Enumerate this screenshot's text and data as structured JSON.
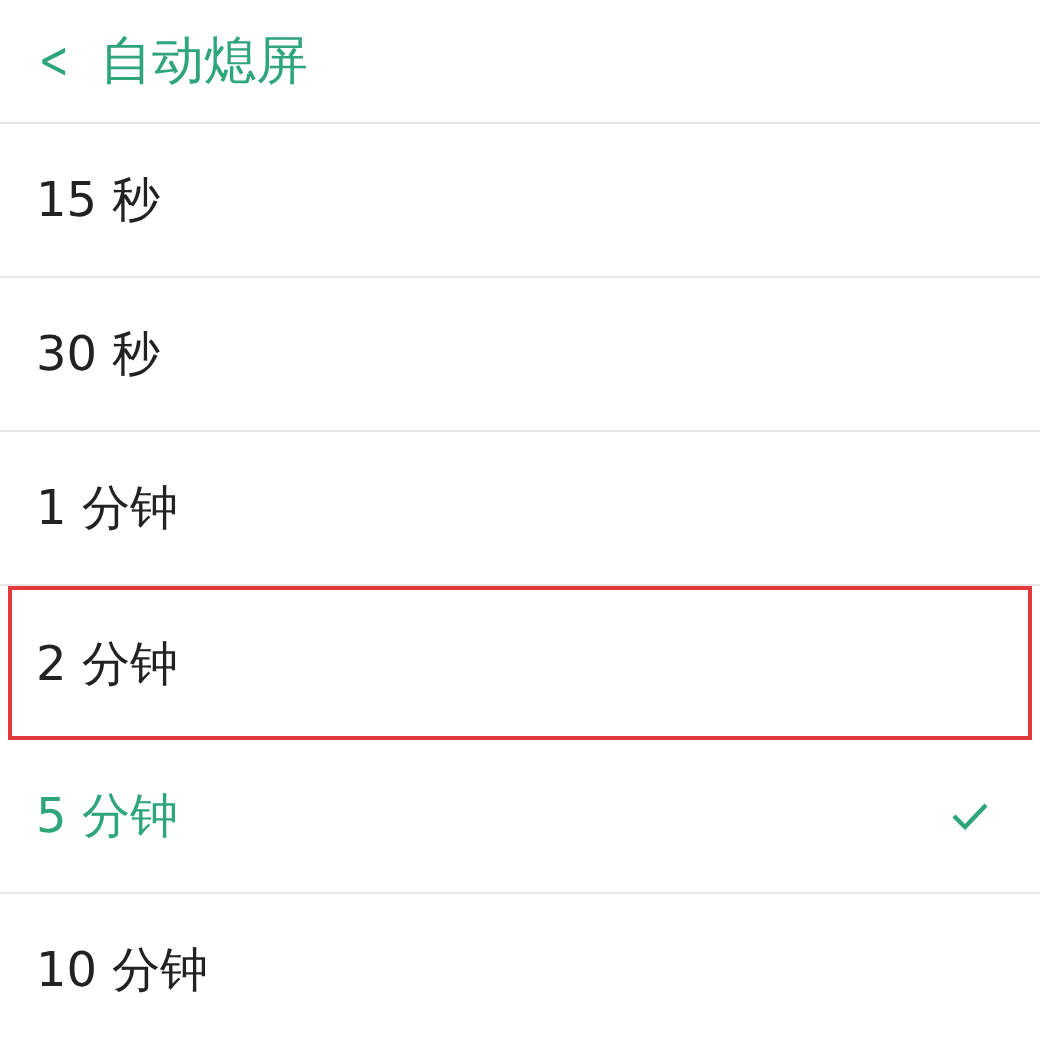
{
  "header": {
    "back_icon": "<",
    "title": "自动熄屏"
  },
  "options": [
    {
      "label": "15 秒",
      "selected": false,
      "highlighted": false
    },
    {
      "label": "30 秒",
      "selected": false,
      "highlighted": false
    },
    {
      "label": "1 分钟",
      "selected": false,
      "highlighted": false
    },
    {
      "label": "2 分钟",
      "selected": false,
      "highlighted": true
    },
    {
      "label": "5 分钟",
      "selected": true,
      "highlighted": false
    },
    {
      "label": "10 分钟",
      "selected": false,
      "highlighted": false
    }
  ]
}
